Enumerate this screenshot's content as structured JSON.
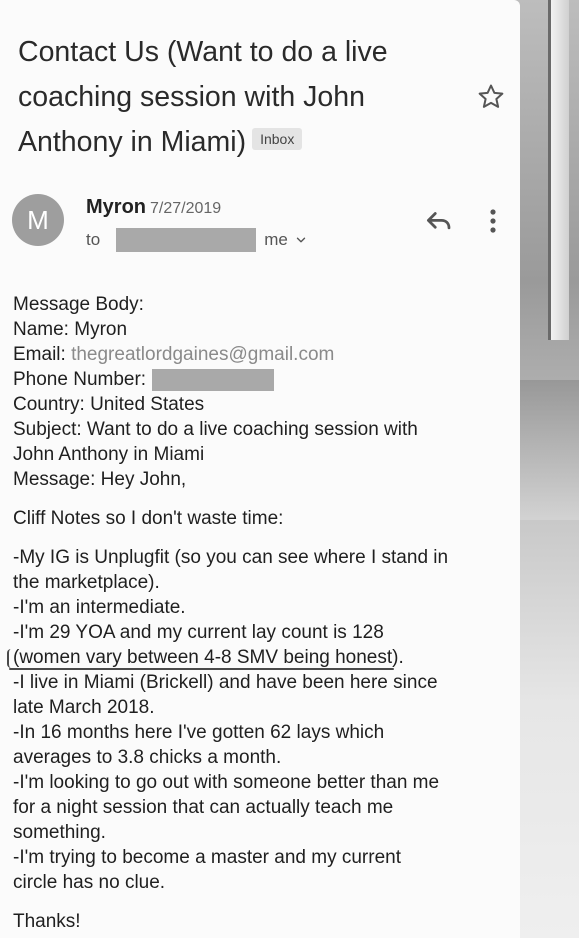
{
  "email": {
    "subject_lines": [
      "Contact Us (Want to do a live",
      "coaching session with John",
      "Anthony in Miami)"
    ],
    "inbox_label": "Inbox",
    "avatar_letter": "M",
    "sender": "Myron",
    "date": "7/27/2019",
    "to_prefix": "to",
    "to_suffix": "me",
    "icons": [
      "star-icon",
      "reply-icon",
      "more-vert-icon",
      "chevron-down-icon"
    ]
  },
  "body": {
    "header_lines": [
      "Message Body:",
      "Name: Myron"
    ],
    "email_label": "Email: ",
    "email_value": "thegreatlordgaines@gmail.com",
    "phone_label": "Phone Number:",
    "details_lines": [
      "Country: United States",
      "Subject: Want to do a live coaching session with",
      "John Anthony in Miami",
      "Message: Hey John,"
    ],
    "cliff": "Cliff Notes so I don't waste time:",
    "bullets_a": [
      "-My IG is Unplugfit (so you can see where I stand in",
      "the marketplace).",
      "-I'm an intermediate.",
      "-I'm 29 YOA and my current lay count is 128"
    ],
    "highlight_text": "(women vary between 4-8 SMV being honest",
    "highlight_tail": ").",
    "bullets_b": [
      "-I live in Miami (Brickell) and have been here since",
      "late March 2018.",
      "-In 16 months here I've gotten 62 lays which",
      "averages to 3.8 chicks a month.",
      "-I'm looking to go out with someone better than me",
      "for a night session that can actually teach me",
      "something.",
      "-I'm trying to become a master and my current",
      "circle has no clue."
    ],
    "closing": "Thanks!"
  }
}
